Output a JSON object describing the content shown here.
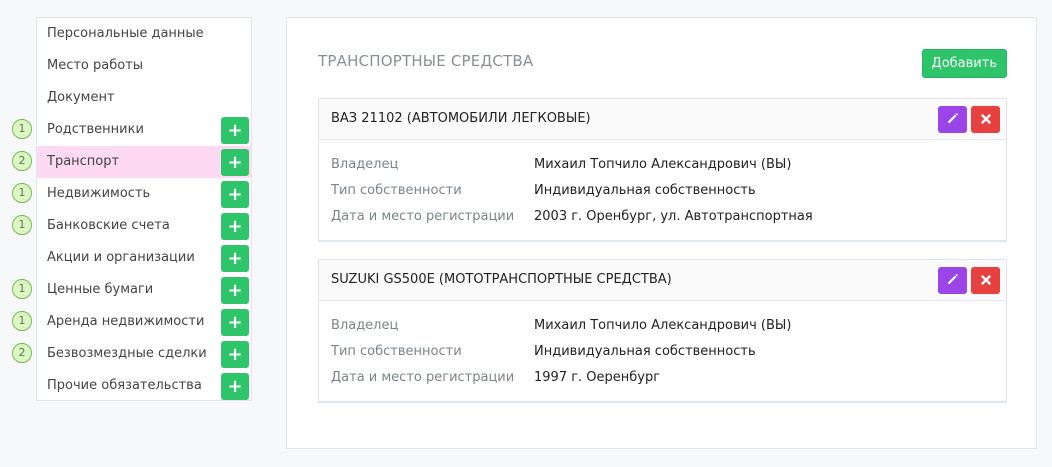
{
  "sidebar": {
    "items": [
      {
        "label": "Персональные данные",
        "count": "",
        "has_add": false,
        "active": false
      },
      {
        "label": "Место работы",
        "count": "",
        "has_add": false,
        "active": false
      },
      {
        "label": "Документ",
        "count": "",
        "has_add": false,
        "active": false
      },
      {
        "label": "Родственники",
        "count": "1",
        "has_add": true,
        "active": false
      },
      {
        "label": "Транспорт",
        "count": "2",
        "has_add": true,
        "active": true
      },
      {
        "label": "Недвижимость",
        "count": "1",
        "has_add": true,
        "active": false
      },
      {
        "label": "Банковские счета",
        "count": "1",
        "has_add": true,
        "active": false
      },
      {
        "label": "Акции и организации",
        "count": "",
        "has_add": true,
        "active": false
      },
      {
        "label": "Ценные бумаги",
        "count": "1",
        "has_add": true,
        "active": false
      },
      {
        "label": "Аренда недвижимости",
        "count": "1",
        "has_add": true,
        "active": false
      },
      {
        "label": "Безвозмездные сделки",
        "count": "2",
        "has_add": true,
        "active": false
      },
      {
        "label": "Прочие обязательства",
        "count": "",
        "has_add": true,
        "active": false
      }
    ],
    "add_glyph": "+"
  },
  "main": {
    "title": "ТРАНСПОРТНЫЕ СРЕДСТВА",
    "add_label": "Добавить",
    "cards": [
      {
        "title": "ВАЗ 21102 (АВТОМОБИЛИ ЛЕГКОВЫЕ)",
        "fields": [
          {
            "label": "Владелец",
            "value": "Михаил Топчило Александрович (ВЫ)"
          },
          {
            "label": "Тип собственности",
            "value": "Индивидуальная собственность"
          },
          {
            "label": "Дата и место регистрации",
            "value": "2003 г. Оренбург, ул. Автотранспортная"
          }
        ]
      },
      {
        "title": "SUZUKI GS500E (МОТОТРАНСПОРТНЫЕ СРЕДСТВА)",
        "fields": [
          {
            "label": "Владелец",
            "value": "Михаил Топчило Александрович (ВЫ)"
          },
          {
            "label": "Тип собственности",
            "value": "Индивидуальная собственность"
          },
          {
            "label": "Дата и место регистрации",
            "value": "1997 г. Оеренбург"
          }
        ]
      }
    ]
  },
  "colors": {
    "accent_green": "#2ec56a",
    "active_bg": "#fdd9f3",
    "edit_purple": "#9b44e8",
    "delete_red": "#e64040",
    "badge_bg": "#dff5c8"
  },
  "icons": {
    "add": "plus-icon",
    "edit": "pencil-icon",
    "delete": "close-icon"
  }
}
